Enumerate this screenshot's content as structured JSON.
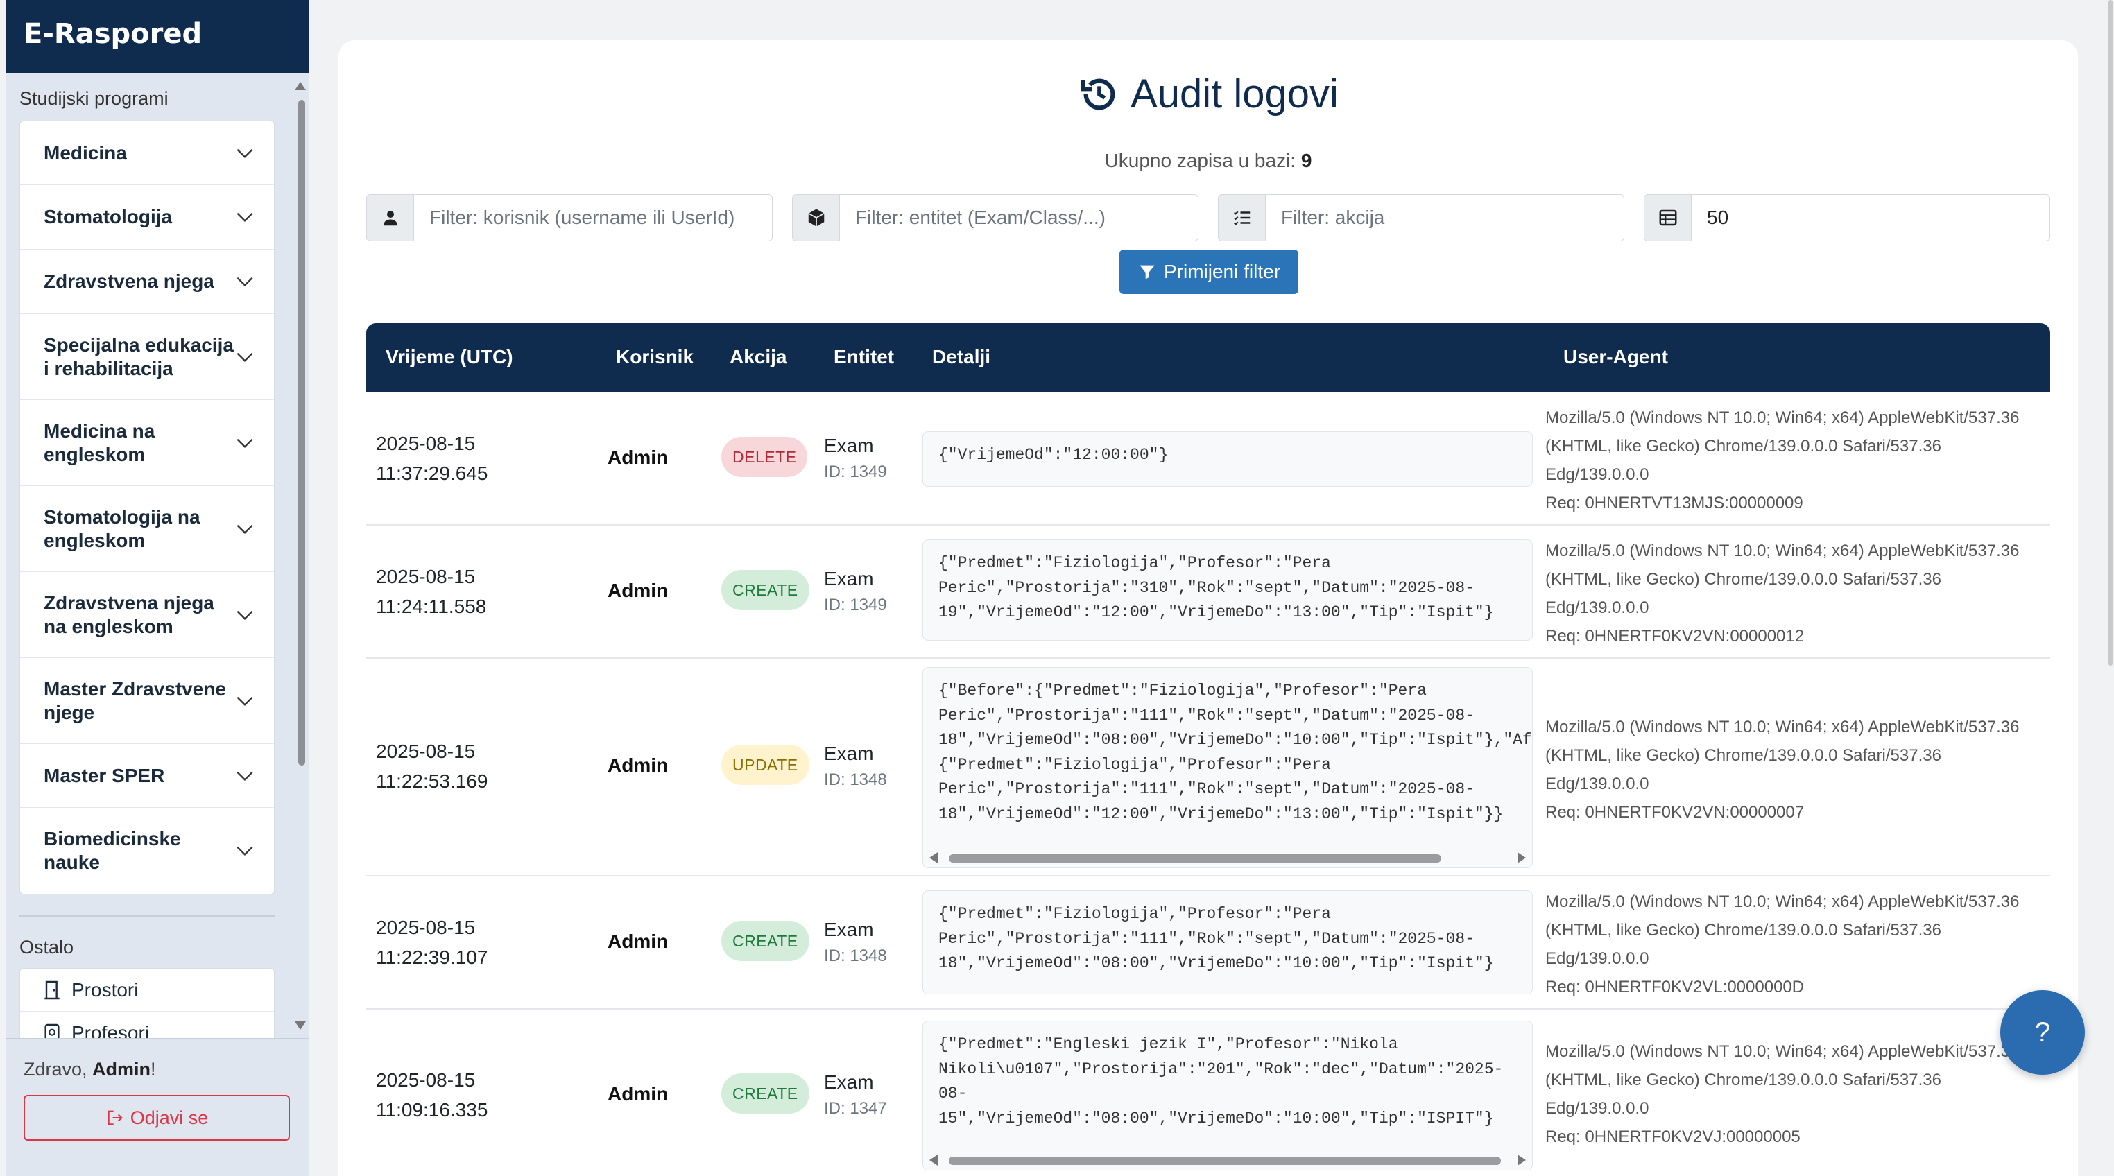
{
  "app": {
    "brand": "E-Raspored"
  },
  "sidebar": {
    "programs_title": "Studijski programi",
    "programs": [
      {
        "label": "Medicina"
      },
      {
        "label": "Stomatologija"
      },
      {
        "label": "Zdravstvena njega"
      },
      {
        "label": "Specijalna edukacija\ni rehabilitacija"
      },
      {
        "label": "Medicina na\nengleskom"
      },
      {
        "label": "Stomatologija na\nengleskom"
      },
      {
        "label": "Zdravstvena njega\nna engleskom"
      },
      {
        "label": "Master Zdravstvene\nnjege"
      },
      {
        "label": "Master SPER"
      },
      {
        "label": "Biomedicinske\nnauke"
      }
    ],
    "other_title": "Ostalo",
    "other": [
      {
        "label": "Prostori",
        "icon": "door-icon"
      },
      {
        "label": "Profesori",
        "icon": "person-badge-icon"
      }
    ],
    "greeting_prefix": "Zdravo, ",
    "greeting_user": "Admin",
    "greeting_suffix": "!",
    "logout_label": "Odjavi se"
  },
  "main": {
    "title": "Audit logovi",
    "total_label": "Ukupno zapisa u bazi: ",
    "total_count": "9",
    "filters": {
      "user_placeholder": "Filter: korisnik (username ili UserId)",
      "entity_placeholder": "Filter: entitet (Exam/Class/...)",
      "action_placeholder": "Filter: akcija",
      "page_size": "50"
    },
    "apply_label": "Primijeni filter",
    "columns": {
      "time": "Vrijeme (UTC)",
      "user": "Korisnik",
      "action": "Akcija",
      "entity": "Entitet",
      "details": "Detalji",
      "ua": "User-Agent"
    },
    "rows": [
      {
        "date": "2025-08-15",
        "time": "11:37:29.645",
        "user": "Admin",
        "action": "DELETE",
        "entity": "Exam",
        "entity_id": "ID: 1349",
        "details": "{\"VrijemeOd\":\"12:00:00\"}",
        "ua1": "Mozilla/5.0 (Windows NT 10.0; Win64; x64) AppleWebKit/537.36",
        "ua2": "(KHTML, like Gecko) Chrome/139.0.0.0 Safari/537.36",
        "ua3": "Edg/139.0.0.0",
        "req": "Req: 0HNERTVT13MJS:00000009"
      },
      {
        "date": "2025-08-15",
        "time": "11:24:11.558",
        "user": "Admin",
        "action": "CREATE",
        "entity": "Exam",
        "entity_id": "ID: 1349",
        "details": "{\"Predmet\":\"Fiziologija\",\"Profesor\":\"Pera\nPeric\",\"Prostorija\":\"310\",\"Rok\":\"sept\",\"Datum\":\"2025-08-\n19\",\"VrijemeOd\":\"12:00\",\"VrijemeDo\":\"13:00\",\"Tip\":\"Ispit\"}",
        "ua1": "Mozilla/5.0 (Windows NT 10.0; Win64; x64) AppleWebKit/537.36",
        "ua2": "(KHTML, like Gecko) Chrome/139.0.0.0 Safari/537.36",
        "ua3": "Edg/139.0.0.0",
        "req": "Req: 0HNERTF0KV2VN:00000012"
      },
      {
        "date": "2025-08-15",
        "time": "11:22:53.169",
        "user": "Admin",
        "action": "UPDATE",
        "entity": "Exam",
        "entity_id": "ID: 1348",
        "details": "{\"Before\":{\"Predmet\":\"Fiziologija\",\"Profesor\":\"Pera\nPeric\",\"Prostorija\":\"111\",\"Rok\":\"sept\",\"Datum\":\"2025-08-\n18\",\"VrijemeOd\":\"08:00\",\"VrijemeDo\":\"10:00\",\"Tip\":\"Ispit\"},\"After\":\n{\"Predmet\":\"Fiziologija\",\"Profesor\":\"Pera\nPeric\",\"Prostorija\":\"111\",\"Rok\":\"sept\",\"Datum\":\"2025-08-\n18\",\"VrijemeOd\":\"12:00\",\"VrijemeDo\":\"13:00\",\"Tip\":\"Ispit\"}}",
        "ua1": "Mozilla/5.0 (Windows NT 10.0; Win64; x64) AppleWebKit/537.36",
        "ua2": "(KHTML, like Gecko) Chrome/139.0.0.0 Safari/537.36",
        "ua3": "Edg/139.0.0.0",
        "req": "Req: 0HNERTF0KV2VN:00000007"
      },
      {
        "date": "2025-08-15",
        "time": "11:22:39.107",
        "user": "Admin",
        "action": "CREATE",
        "entity": "Exam",
        "entity_id": "ID: 1348",
        "details": "{\"Predmet\":\"Fiziologija\",\"Profesor\":\"Pera\nPeric\",\"Prostorija\":\"111\",\"Rok\":\"sept\",\"Datum\":\"2025-08-\n18\",\"VrijemeOd\":\"08:00\",\"VrijemeDo\":\"10:00\",\"Tip\":\"Ispit\"}",
        "ua1": "Mozilla/5.0 (Windows NT 10.0; Win64; x64) AppleWebKit/537.36",
        "ua2": "(KHTML, like Gecko) Chrome/139.0.0.0 Safari/537.36",
        "ua3": "Edg/139.0.0.0",
        "req": "Req: 0HNERTF0KV2VL:0000000D"
      },
      {
        "date": "2025-08-15",
        "time": "11:09:16.335",
        "user": "Admin",
        "action": "CREATE",
        "entity": "Exam",
        "entity_id": "ID: 1347",
        "details": "{\"Predmet\":\"Engleski jezik I\",\"Profesor\":\"Nikola\nNikoli\\u0107\",\"Prostorija\":\"201\",\"Rok\":\"dec\",\"Datum\":\"2025-\n08-\n15\",\"VrijemeOd\":\"08:00\",\"VrijemeDo\":\"10:00\",\"Tip\":\"ISPIT\"}",
        "ua1": "Mozilla/5.0 (Windows NT 10.0; Win64; x64) AppleWebKit/537.36",
        "ua2": "(KHTML, like Gecko) Chrome/139.0.0.0 Safari/537.36",
        "ua3": "Edg/139.0.0.0",
        "req": "Req: 0HNERTF0KV2VJ:00000005"
      }
    ]
  },
  "help_label": "?",
  "colors": {
    "navy": "#0f2b4d",
    "primary": "#2b74b8",
    "danger": "#dc3545"
  }
}
